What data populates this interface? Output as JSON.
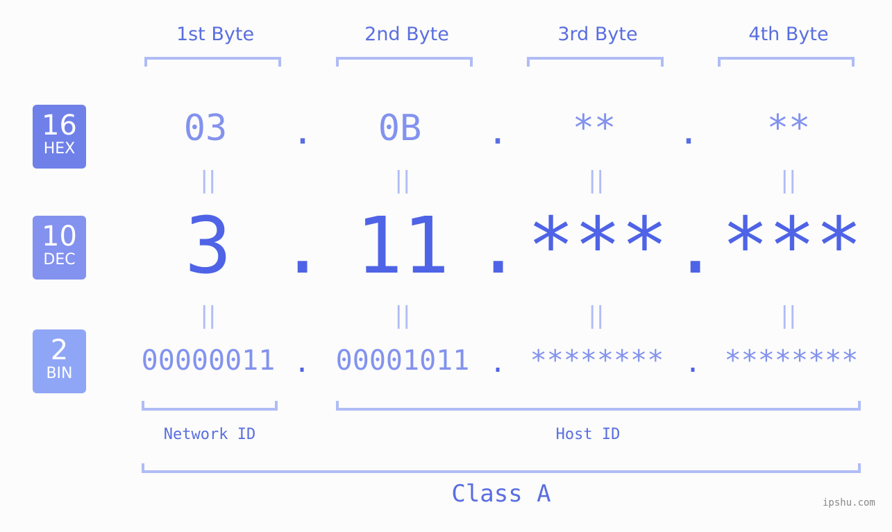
{
  "byte_headers": [
    "1st Byte",
    "2nd Byte",
    "3rd Byte",
    "4th Byte"
  ],
  "badges": {
    "hex": {
      "number": "16",
      "label": "HEX",
      "color": "#6f80e8"
    },
    "dec": {
      "number": "10",
      "label": "DEC",
      "color": "#8391ef"
    },
    "bin": {
      "number": "2",
      "label": "BIN",
      "color": "#8fa6f6"
    }
  },
  "hex_values": [
    "03",
    "0B",
    "**",
    "**"
  ],
  "dec_values": [
    "3",
    "11",
    "***",
    "***"
  ],
  "bin_values": [
    "00000011",
    "00001011",
    "********",
    "********"
  ],
  "separator": ".",
  "equals_sign": "||",
  "network_id_label": "Network ID",
  "host_id_label": "Host ID",
  "class_label": "Class A",
  "brand": "ipshu.com"
}
